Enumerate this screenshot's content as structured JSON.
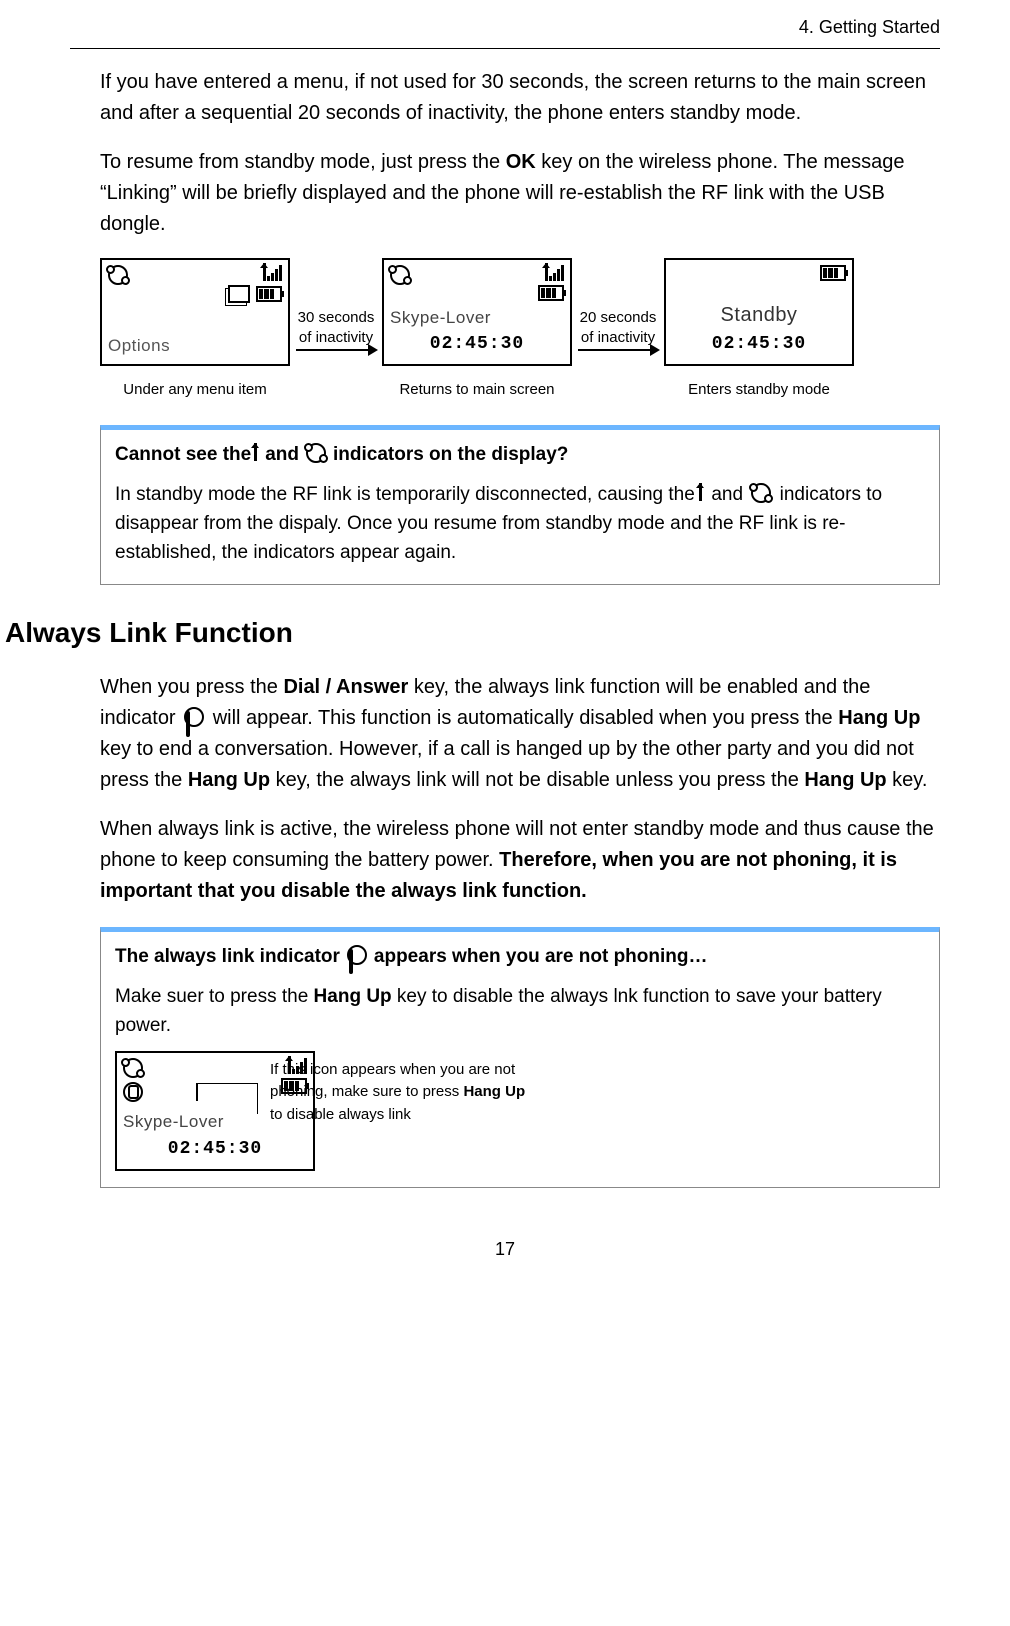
{
  "header": {
    "chapter": "4. Getting Started"
  },
  "p1": {
    "text": "If you have entered a menu, if not used for 30 seconds, the screen returns to the main screen and after a sequential 20 seconds of inactivity, the phone enters standby mode."
  },
  "p2": {
    "t1": "To resume from standby mode, just press the ",
    "k1": "OK",
    "t2": " key on the wireless phone. The message “Linking” will be briefly displayed and the phone will re-establish the RF link with the USB dongle."
  },
  "flow": {
    "screen1_label": "Options",
    "caption1": "Under any menu item",
    "arrow1a": "30 seconds",
    "arrow1b": "of inactivity",
    "screen2_name": "Skype-Lover",
    "screen2_time": "02:45:30",
    "caption2": "Returns to main screen",
    "arrow2a": "20 seconds",
    "arrow2b": "of inactivity",
    "screen3_label": "Standby",
    "screen3_time": "02:45:30",
    "caption3": "Enters standby mode"
  },
  "note1": {
    "title_a": "Cannot see the",
    "title_b": "and",
    "title_c": "indicators on the display?",
    "body_a": "In standby mode the RF link is temporarily disconnected, causing the",
    "body_b": "and",
    "body_c": "indicators to disappear from the dispaly. Once you resume from standby mode and the RF link is re-established, the indicators appear again."
  },
  "h2": "Always Link Function",
  "p3": {
    "t1": "When you press the ",
    "k1": "Dial / Answer",
    "t2": " key, the always link function will be enabled and the indicator ",
    "t3": " will appear. This function is automatically disabled when you press the ",
    "k2": "Hang Up",
    "t4": " key to end a conversation. However, if a call is hanged up by the other party and you did not press the ",
    "k3": "Hang Up",
    "t5": " key, the always link will not be disable unless you press the ",
    "k4": "Hang Up",
    "t6": " key."
  },
  "p4": {
    "t1": "When always link is active, the wireless phone will not enter standby mode and thus cause the phone to keep consuming the battery power. ",
    "k1": "Therefore, when you are not phoning, it is important that you disable the always link function."
  },
  "note2": {
    "title_a": "The always link indicator",
    "title_b": "appears when you are not phoning…",
    "body_a": "Make suer to press the ",
    "body_k": "Hang Up",
    "body_b": " key to disable the always lnk function to save your battery power.",
    "screen_name": "Skype-Lover",
    "screen_time": "02:45:30",
    "side_a": "If this icon appears when you are not phoning, make sure to press ",
    "side_k": "Hang Up",
    "side_b": " to disable always link"
  },
  "page_number": "17"
}
